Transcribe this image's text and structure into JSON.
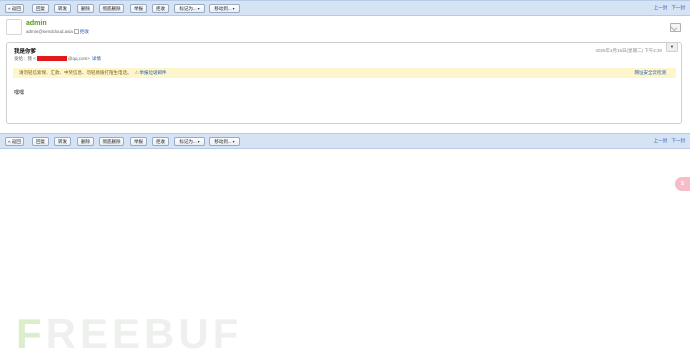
{
  "toolbar": {
    "back": "« 返回",
    "reply": "回复",
    "forward": "转发",
    "delete": "删除",
    "delete_permanent": "彻底删除",
    "report": "举报",
    "reject": "拒收",
    "mark_as": "标记为...",
    "move_to": "移动到...",
    "prev": "上一封",
    "next": "下一封"
  },
  "sender": {
    "name": "admin",
    "address": "admin@sendcloud.asia",
    "reject_link": "拒收"
  },
  "mail": {
    "subject": "我是你爹",
    "recipient_prefix": "发给：",
    "recipient_name": "我 <",
    "recipient_suffix": "@qq.com>",
    "detail_link": "详情",
    "date": "2025年4月15日(星期二) 下午2:30",
    "expand_label": "▼",
    "warning_text": "请勿轻信索保、汇款、中奖信息、勿轻易拨打陌生电话。",
    "report_link": "举报垃圾邮件",
    "cloud_check": "网址安全云检测",
    "body": "嘿嘿"
  },
  "float_pill_label": "S",
  "watermark": {
    "first": "F",
    "rest": "REEBUF"
  }
}
